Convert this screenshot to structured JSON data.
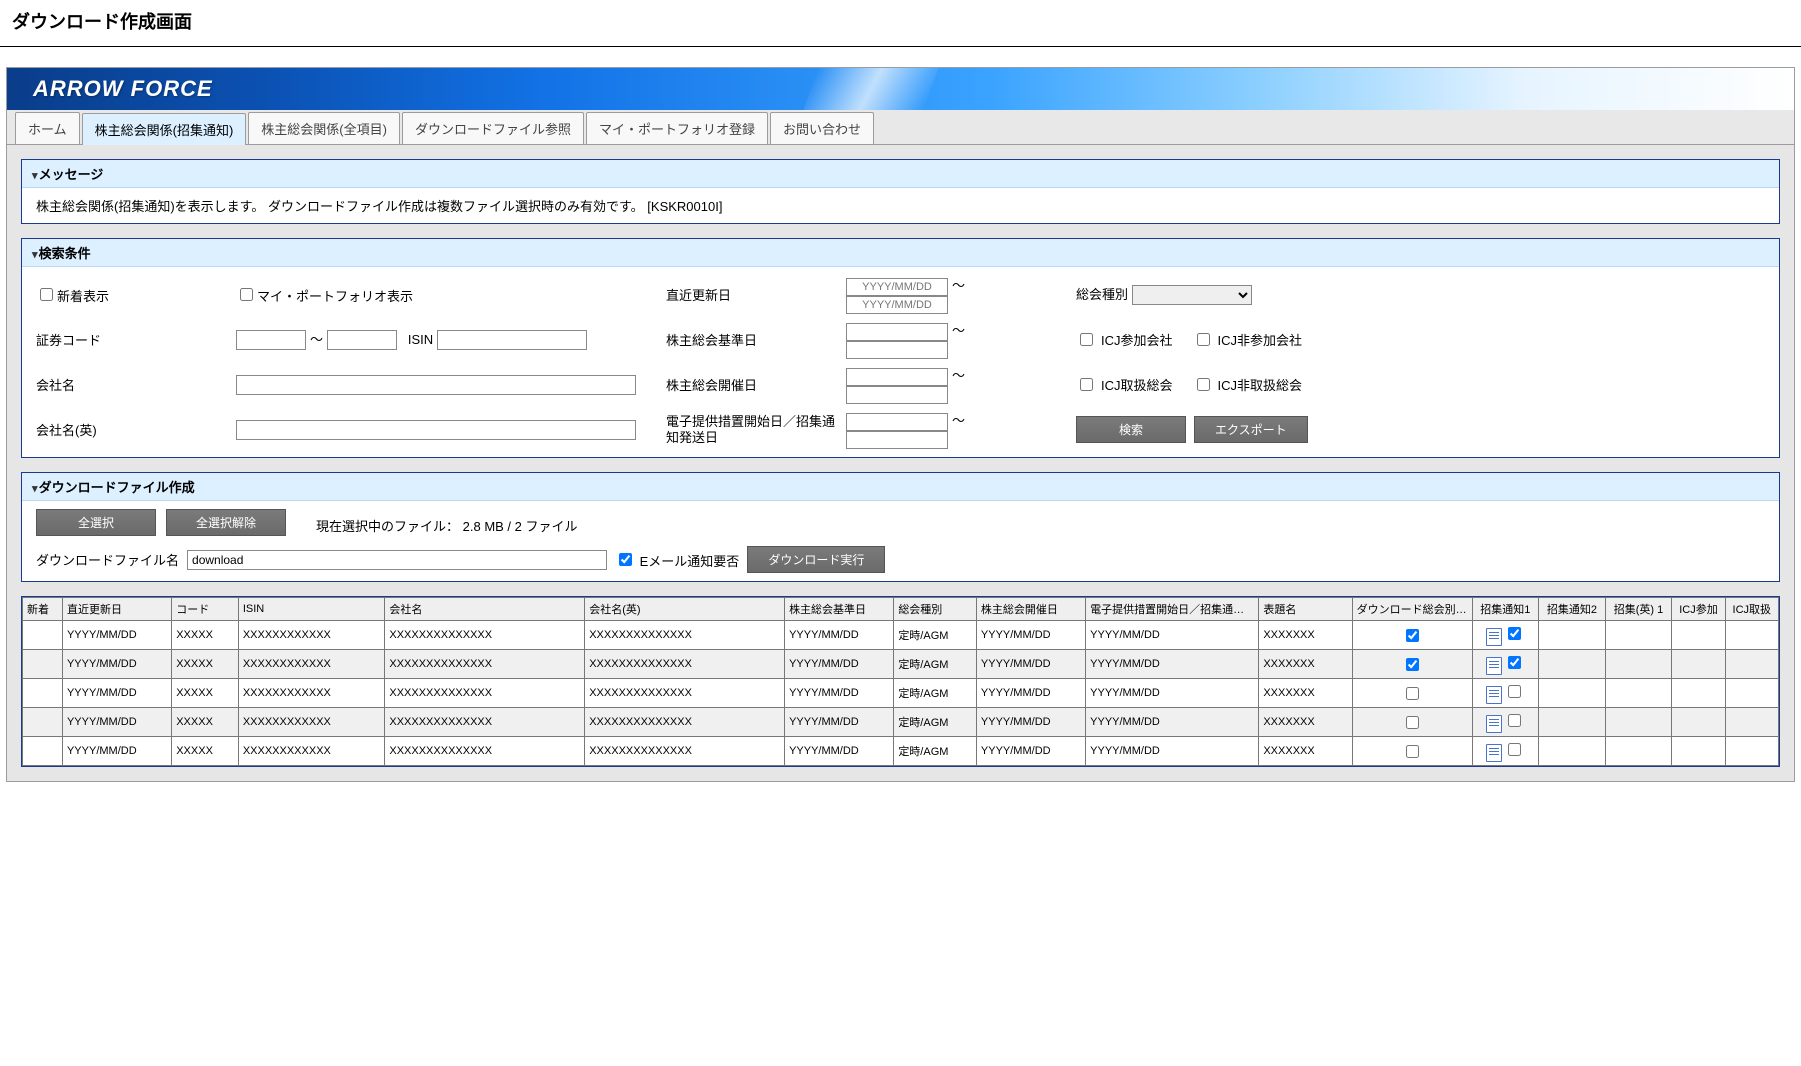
{
  "page": {
    "title": "ダウンロード作成画面"
  },
  "banner": {
    "product": "ARROW FORCE"
  },
  "tabs": [
    {
      "id": "home",
      "label": "ホーム"
    },
    {
      "id": "shoshu",
      "label": "株主総会関係(招集通知)",
      "active": true
    },
    {
      "id": "zenkoumoku",
      "label": "株主総会関係(全項目)"
    },
    {
      "id": "dlref",
      "label": "ダウンロードファイル参照"
    },
    {
      "id": "portfolio",
      "label": "マイ・ポートフォリオ登録"
    },
    {
      "id": "contact",
      "label": "お問い合わせ"
    }
  ],
  "message": {
    "header": "メッセージ",
    "body": "株主総会関係(招集通知)を表示します。 ダウンロードファイル作成は複数ファイル選択時のみ有効です。 [KSKR0010I]"
  },
  "search": {
    "header": "検索条件",
    "labels": {
      "new": "新着表示",
      "portfolio": "マイ・ポートフォリオ表示",
      "recentUpdate": "直近更新日",
      "sokaiType": "総会種別",
      "secCode": "証券コード",
      "isin": "ISIN",
      "kijunDate": "株主総会基準日",
      "kaisaiDate": "株主総会開催日",
      "companyJa": "会社名",
      "companyEn": "会社名(英)",
      "elecStart": "電子提供措置開始日／招集通知発送日",
      "icjMember": "ICJ参加会社",
      "icjNonMember": "ICJ非参加会社",
      "icjHandled": "ICJ取扱総会",
      "icjNotHandled": "ICJ非取扱総会",
      "searchBtn": "検索",
      "exportBtn": "エクスポート"
    },
    "placeholders": {
      "date": "YYYY/MM/DD"
    }
  },
  "download": {
    "header": "ダウンロードファイル作成",
    "selectAll": "全選択",
    "clearAll": "全選択解除",
    "fileNameLabel": "ダウンロードファイル名",
    "fileName": "download",
    "emailNotify": "Eメール通知要否",
    "emailNotifyChecked": true,
    "execute": "ダウンロード実行",
    "statusPrefix": "現在選択中のファイル：",
    "statusValue": "2.8 MB / 2 ファイル"
  },
  "table": {
    "headers": {
      "new": "新着",
      "recent": "直近更新日",
      "code": "コード",
      "isin": "ISIN",
      "companyJa": "会社名",
      "companyEn": "会社名(英)",
      "kijun": "株主総会基準日",
      "type": "総会種別",
      "kaisai": "株主総会開催日",
      "elec": "電子提供措置開始日／招集通知発送日",
      "topic": "表題名",
      "dlAll": "ダウンロード総会別全選択",
      "notice1": "招集通知1",
      "notice2": "招集通知2",
      "noticeEn1": "招集(英) 1",
      "icjMember": "ICJ参加",
      "icjHandled": "ICJ取扱"
    },
    "rows": [
      {
        "recent": "YYYY/MM/DD",
        "code": "XXXXX",
        "isin": "XXXXXXXXXXXX",
        "ja": "XXXXXXXXXXXXXX",
        "en": "XXXXXXXXXXXXXX",
        "kijun": "YYYY/MM/DD",
        "type": "定時/AGM",
        "kaisai": "YYYY/MM/DD",
        "elec": "YYYY/MM/DD",
        "topic": "XXXXXXX",
        "dlAll": true,
        "n1": true
      },
      {
        "recent": "YYYY/MM/DD",
        "code": "XXXXX",
        "isin": "XXXXXXXXXXXX",
        "ja": "XXXXXXXXXXXXXX",
        "en": "XXXXXXXXXXXXXX",
        "kijun": "YYYY/MM/DD",
        "type": "定時/AGM",
        "kaisai": "YYYY/MM/DD",
        "elec": "YYYY/MM/DD",
        "topic": "XXXXXXX",
        "dlAll": true,
        "n1": true
      },
      {
        "recent": "YYYY/MM/DD",
        "code": "XXXXX",
        "isin": "XXXXXXXXXXXX",
        "ja": "XXXXXXXXXXXXXX",
        "en": "XXXXXXXXXXXXXX",
        "kijun": "YYYY/MM/DD",
        "type": "定時/AGM",
        "kaisai": "YYYY/MM/DD",
        "elec": "YYYY/MM/DD",
        "topic": "XXXXXXX",
        "dlAll": false,
        "n1": false
      },
      {
        "recent": "YYYY/MM/DD",
        "code": "XXXXX",
        "isin": "XXXXXXXXXXXX",
        "ja": "XXXXXXXXXXXXXX",
        "en": "XXXXXXXXXXXXXX",
        "kijun": "YYYY/MM/DD",
        "type": "定時/AGM",
        "kaisai": "YYYY/MM/DD",
        "elec": "YYYY/MM/DD",
        "topic": "XXXXXXX",
        "dlAll": false,
        "n1": false
      },
      {
        "recent": "YYYY/MM/DD",
        "code": "XXXXX",
        "isin": "XXXXXXXXXXXX",
        "ja": "XXXXXXXXXXXXXX",
        "en": "XXXXXXXXXXXXXX",
        "kijun": "YYYY/MM/DD",
        "type": "定時/AGM",
        "kaisai": "YYYY/MM/DD",
        "elec": "YYYY/MM/DD",
        "topic": "XXXXXXX",
        "dlAll": false,
        "n1": false
      }
    ]
  }
}
